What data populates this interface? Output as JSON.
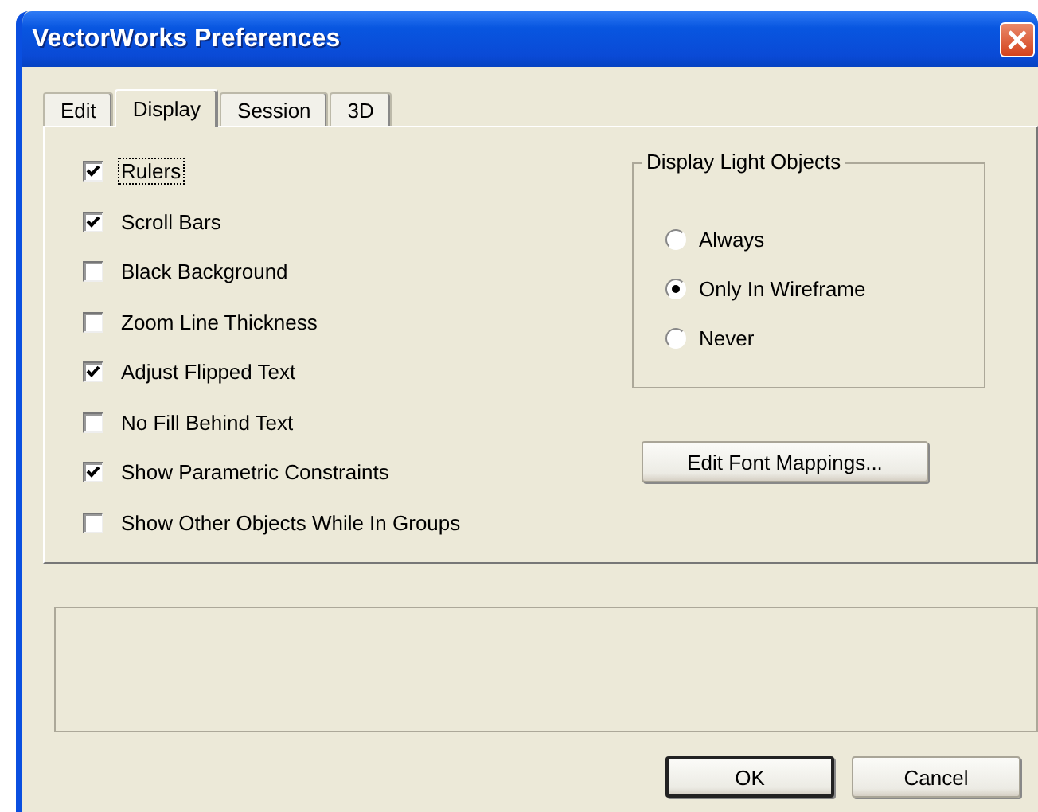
{
  "window": {
    "title": "VectorWorks Preferences"
  },
  "tabs": [
    {
      "label": "Edit",
      "selected": false
    },
    {
      "label": "Display",
      "selected": true
    },
    {
      "label": "Session",
      "selected": false
    },
    {
      "label": "3D",
      "selected": false
    }
  ],
  "options": [
    {
      "label": "Rulers",
      "checked": true,
      "focused": true
    },
    {
      "label": "Scroll Bars",
      "checked": true,
      "focused": false
    },
    {
      "label": "Black Background",
      "checked": false,
      "focused": false
    },
    {
      "label": "Zoom Line Thickness",
      "checked": false,
      "focused": false
    },
    {
      "label": "Adjust Flipped Text",
      "checked": true,
      "focused": false
    },
    {
      "label": "No Fill Behind Text",
      "checked": false,
      "focused": false
    },
    {
      "label": "Show Parametric Constraints",
      "checked": true,
      "focused": false
    },
    {
      "label": "Show Other Objects While In Groups",
      "checked": false,
      "focused": false
    }
  ],
  "light_objects": {
    "title": "Display Light Objects",
    "options": [
      {
        "label": "Always",
        "selected": false
      },
      {
        "label": "Only In Wireframe",
        "selected": true
      },
      {
        "label": "Never",
        "selected": false
      }
    ]
  },
  "font_mappings_button": "Edit Font Mappings...",
  "buttons": [
    {
      "label": "OK",
      "default": true
    },
    {
      "label": "Cancel",
      "default": false
    }
  ]
}
